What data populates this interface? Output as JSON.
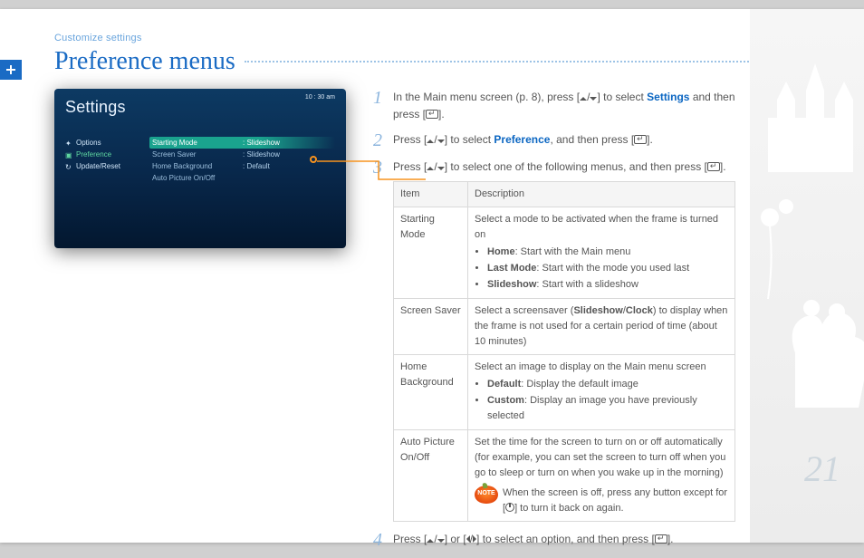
{
  "breadcrumb": "Customize settings",
  "title": "Preference menus",
  "page_number": "21",
  "left_tab_icon": "plus-icon",
  "device": {
    "time": "10 : 30 am",
    "heading": "Settings",
    "nav": [
      {
        "icon": "gear-icon",
        "label": "Options"
      },
      {
        "icon": "person-icon",
        "label": "Preference"
      },
      {
        "icon": "refresh-icon",
        "label": "Update/Reset"
      }
    ],
    "active_nav_index": 1,
    "menu": [
      {
        "label": "Starting Mode",
        "value": ": Slideshow",
        "highlighted": true
      },
      {
        "label": "Screen Saver",
        "value": ": Slideshow",
        "highlighted": false
      },
      {
        "label": "Home Background",
        "value": ": Default",
        "highlighted": false
      },
      {
        "label": "Auto Picture On/Off",
        "value": "",
        "highlighted": false
      }
    ]
  },
  "steps": {
    "s1": {
      "n": "1",
      "pre": "In the Main menu screen (p. 8), press [",
      "post_select": "] to select ",
      "settings_word": "Settings",
      "and_press": " and then press [",
      "end": "]."
    },
    "s2": {
      "n": "2",
      "pre": "Press [",
      "mid": "] to select ",
      "pref_word": "Preference",
      "and_press": ", and then press [",
      "end": "]."
    },
    "s3": {
      "n": "3",
      "pre": "Press [",
      "mid": "] to select one of the following menus, and then press [",
      "end": "]."
    },
    "s4": {
      "n": "4",
      "pre": "Press [",
      "or": "] or [",
      "mid": "] to select an option, and then press [",
      "end": "]."
    }
  },
  "table": {
    "head_item": "Item",
    "head_desc": "Description",
    "rows": {
      "starting_mode": {
        "item": "Starting Mode",
        "lead": "Select a mode to be activated when the frame is turned on",
        "b1_label": "Home",
        "b1_text": ": Start with the Main menu",
        "b2_label": "Last Mode",
        "b2_text": ": Start with the mode you used last",
        "b3_label": "Slideshow",
        "b3_text": ": Start with a slideshow"
      },
      "screen_saver": {
        "item": "Screen Saver",
        "pre": "Select a screensaver (",
        "opt1": "Slideshow",
        "slash": "/",
        "opt2": "Clock",
        "post": ") to display when the frame is not used for a certain period of time (about 10 minutes)"
      },
      "home_bg": {
        "item": "Home Background",
        "lead": "Select an image to display on the Main menu screen",
        "b1_label": "Default",
        "b1_text": ": Display the default image",
        "b2_label": "Custom",
        "b2_text": ": Display an image you have previously selected"
      },
      "auto_pic": {
        "item": "Auto Picture On/Off",
        "lead": "Set the time for the screen to turn on or off automatically (for example, you can set the screen to turn off when you go to sleep or turn on when you wake up in the morning)",
        "note_label": "NOTE",
        "note_pre": "When the screen is off, press any button except for [",
        "note_post": "] to turn it back on again."
      }
    }
  }
}
